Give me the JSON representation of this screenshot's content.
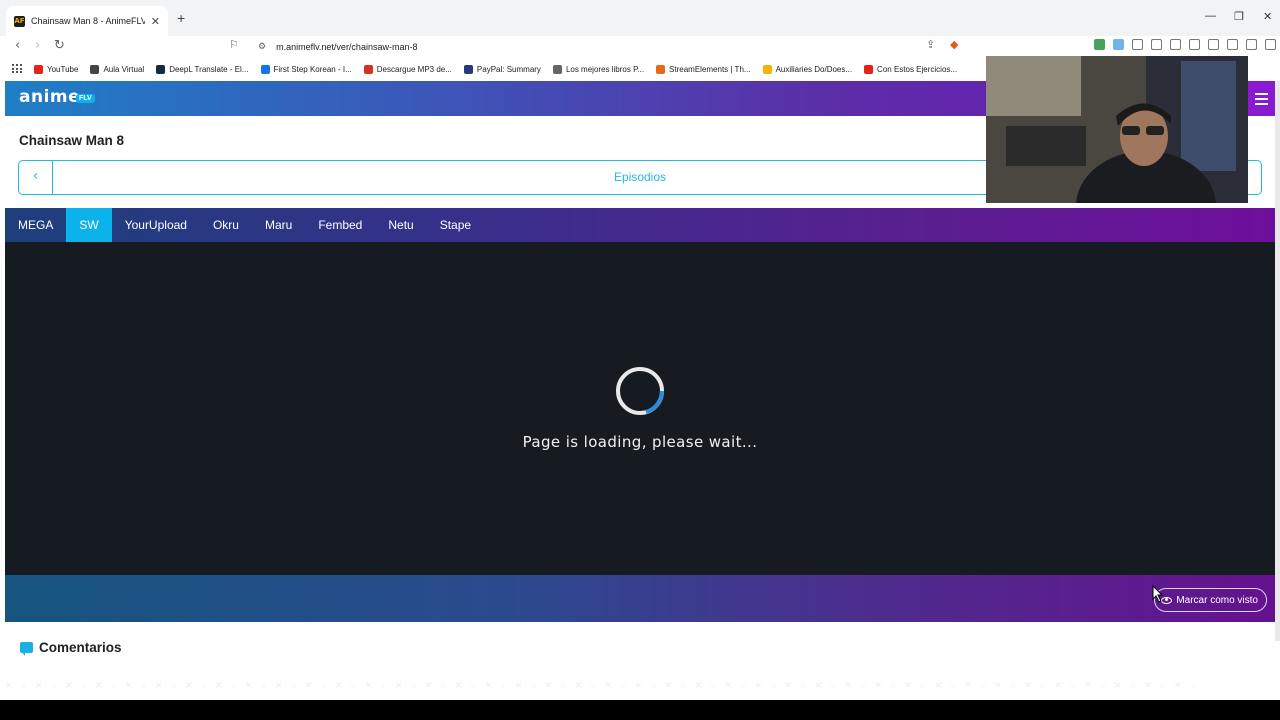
{
  "browser": {
    "tab_title": "Chainsaw Man 8 - AnimeFLV",
    "favicon_text": "AF",
    "url": "m.animeflv.net/ver/chainsaw-man-8",
    "bookmarks": [
      {
        "label": "YouTube",
        "color": "#e62117"
      },
      {
        "label": "Aula Virtual",
        "color": "#444444"
      },
      {
        "label": "DeepL Translate - El...",
        "color": "#0f2b46"
      },
      {
        "label": "First Step Korean - I...",
        "color": "#1a73e8"
      },
      {
        "label": "Descargue MP3 de...",
        "color": "#d93025"
      },
      {
        "label": "PayPal: Summary",
        "color": "#253b80"
      },
      {
        "label": "Los mejores libros P...",
        "color": "#666666"
      },
      {
        "label": "StreamElements | Th...",
        "color": "#e36b1a"
      },
      {
        "label": "Auxiliaries Do/Does...",
        "color": "#f4b400"
      },
      {
        "label": "Con Estos Ejercicios...",
        "color": "#e62117"
      }
    ]
  },
  "site": {
    "logo": "anime",
    "logo_badge": "FLV",
    "episode_title": "Chainsaw Man 8",
    "episodes_label": "Episodios",
    "servers": [
      "MEGA",
      "SW",
      "YourUpload",
      "Okru",
      "Maru",
      "Fembed",
      "Netu",
      "Stape"
    ],
    "active_server": "SW",
    "loading_text": "Page is loading, please wait...",
    "mark_watched": "Marcar como visto",
    "comments_title": "Comentarios"
  },
  "colors": {
    "accent": "#0bb3ea",
    "player_bg": "#161b22"
  }
}
